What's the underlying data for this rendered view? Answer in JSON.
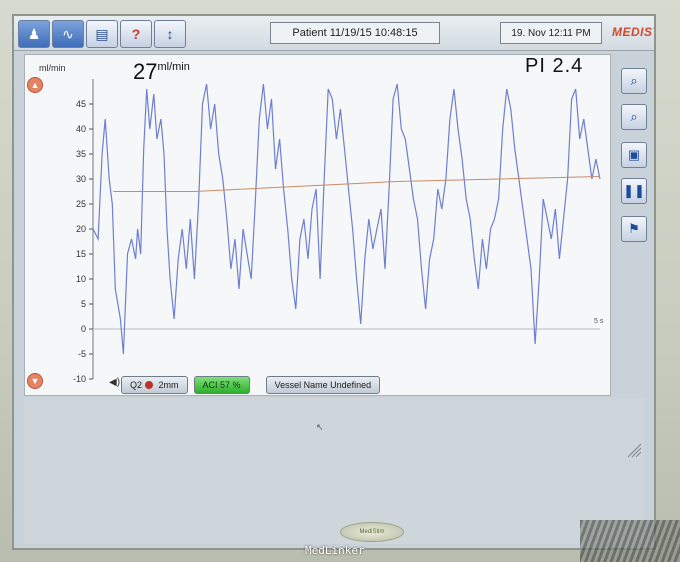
{
  "toolbar": {
    "buttons": [
      {
        "icon": "patient-icon",
        "glyph": "♟"
      },
      {
        "icon": "waveform-icon",
        "glyph": "∿"
      },
      {
        "icon": "folder-icon",
        "glyph": "▤"
      },
      {
        "icon": "help-icon",
        "glyph": "?"
      },
      {
        "icon": "settings-icon",
        "glyph": "↕"
      }
    ],
    "patient": "Patient 11/19/15 10:48:15",
    "clock": "19. Nov 12:11 PM",
    "brand": "MEDISTI"
  },
  "readouts": {
    "flow_value": "27",
    "flow_unit": "ml/min",
    "pi_label": "PI",
    "pi_value": "2.4"
  },
  "status": {
    "probe": "Q2",
    "probe_size": "2mm",
    "aci": "ACI 57 %",
    "vessel": "Vessel Name Undefined"
  },
  "tools": [
    {
      "icon": "zoom-in-icon",
      "glyph": "🔍"
    },
    {
      "icon": "zoom-out-icon",
      "glyph": "🔍"
    },
    {
      "icon": "save-icon",
      "glyph": "▣"
    },
    {
      "icon": "pause-icon",
      "glyph": "❚❚"
    },
    {
      "icon": "marker-icon",
      "glyph": "⚑"
    }
  ],
  "footer": {
    "logo_text": "MediStim",
    "watermark": "MedLinker"
  },
  "colors": {
    "flow_line": "#6f7fd0",
    "mean_line": "#c98a6a",
    "aci_green": "#2fae2c"
  },
  "chart_data": {
    "type": "line",
    "title": "",
    "ylabel": "ml/min",
    "xlabel": "s",
    "ylim": [
      -10,
      50
    ],
    "yticks": [
      45,
      40,
      35,
      30,
      25,
      20,
      15,
      10,
      5,
      0,
      -5,
      -10
    ],
    "xlim": [
      0,
      5
    ],
    "x_end_label": "5 s",
    "series": [
      {
        "x": [
          0.0,
          0.05,
          0.09,
          0.12,
          0.16,
          0.19,
          0.22,
          0.27,
          0.3,
          0.34,
          0.38,
          0.42,
          0.44,
          0.47,
          0.5,
          0.53,
          0.56,
          0.6,
          0.63,
          0.67,
          0.7,
          0.73,
          0.76,
          0.8,
          0.84,
          0.88,
          0.92,
          0.96,
          1.0,
          1.04,
          1.08,
          1.12,
          1.16,
          1.2,
          1.24,
          1.28,
          1.32,
          1.36,
          1.4,
          1.44,
          1.48,
          1.52,
          1.56,
          1.6,
          1.64,
          1.68,
          1.72,
          1.76,
          1.8,
          1.84,
          1.88,
          1.92,
          1.96,
          2.0,
          2.04,
          2.08,
          2.12,
          2.16,
          2.2,
          2.24,
          2.28,
          2.32,
          2.36,
          2.4,
          2.44,
          2.48,
          2.52,
          2.56,
          2.6,
          2.64,
          2.68,
          2.72,
          2.76,
          2.8,
          2.84,
          2.88,
          2.92,
          2.96,
          3.0,
          3.04,
          3.08,
          3.12,
          3.16,
          3.2,
          3.24,
          3.28,
          3.32,
          3.36,
          3.4,
          3.44,
          3.48,
          3.52,
          3.56,
          3.6,
          3.64,
          3.68,
          3.72,
          3.76,
          3.8,
          3.84,
          3.88,
          3.92,
          3.96,
          4.0,
          4.04,
          4.08,
          4.12,
          4.16,
          4.2,
          4.24,
          4.28,
          4.32,
          4.36,
          4.4,
          4.44,
          4.48,
          4.52,
          4.56,
          4.6,
          4.64,
          4.68,
          4.72,
          4.76,
          4.8,
          4.84,
          4.88,
          4.92,
          4.96,
          5.0
        ],
        "values": [
          20,
          18,
          35,
          42,
          30,
          25,
          8,
          2,
          -5,
          15,
          18,
          14,
          20,
          15,
          36,
          48,
          40,
          47,
          38,
          42,
          35,
          20,
          10,
          2,
          14,
          20,
          12,
          22,
          10,
          25,
          45,
          49,
          40,
          45,
          35,
          30,
          22,
          12,
          18,
          8,
          20,
          15,
          10,
          25,
          42,
          49,
          40,
          46,
          32,
          38,
          28,
          20,
          10,
          4,
          18,
          22,
          14,
          24,
          28,
          10,
          30,
          48,
          46,
          38,
          44,
          36,
          28,
          20,
          10,
          1,
          14,
          22,
          16,
          20,
          24,
          12,
          28,
          46,
          49,
          40,
          38,
          32,
          26,
          22,
          12,
          4,
          14,
          18,
          28,
          24,
          30,
          42,
          48,
          40,
          34,
          26,
          22,
          14,
          8,
          18,
          12,
          20,
          22,
          26,
          40,
          48,
          44,
          36,
          30,
          24,
          18,
          12,
          -3,
          10,
          26,
          22,
          18,
          24,
          14,
          22,
          30,
          46,
          48,
          38,
          42,
          36,
          30,
          34,
          30
        ]
      },
      {
        "x": [
          0.2,
          1.0,
          2.0,
          3.0,
          4.0,
          5.0
        ],
        "values": [
          27.5,
          27.5,
          28.5,
          29.5,
          30,
          30.5
        ]
      }
    ],
    "grid": false,
    "legend": "none"
  }
}
